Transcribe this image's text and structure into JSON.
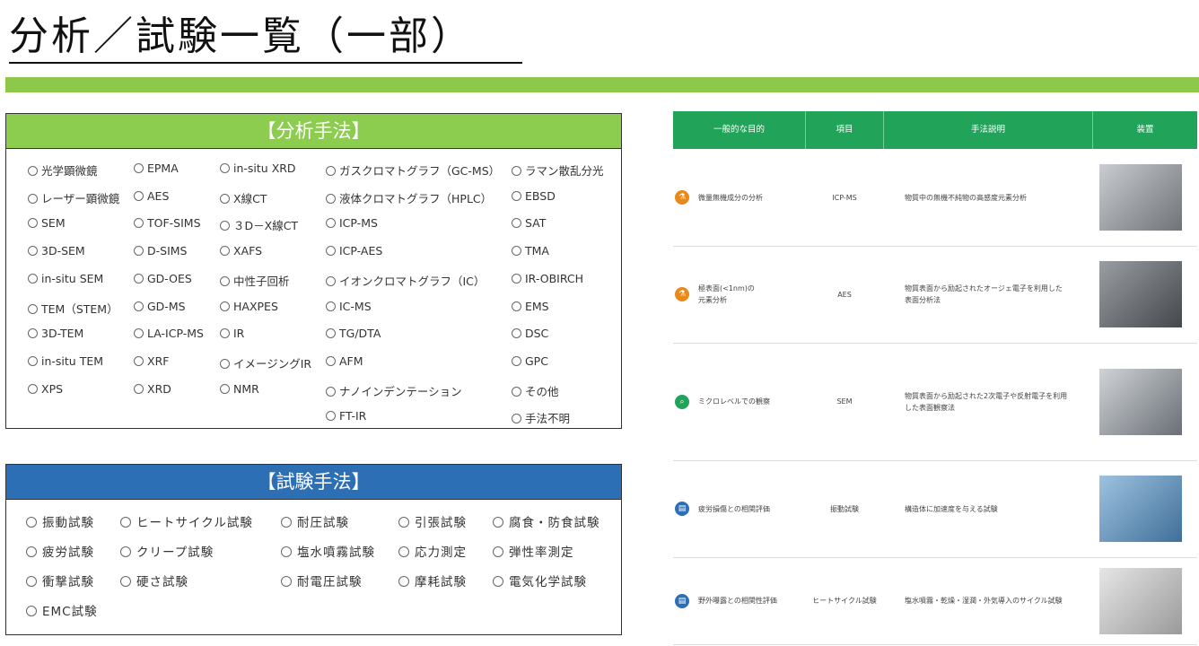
{
  "title": "分析／試験一覧（一部）",
  "colors": {
    "green_band": "#8dc84b",
    "analysis_header": "#8ccd4f",
    "test_header": "#2d6fb5",
    "table_header": "#21a35a"
  },
  "analysis": {
    "heading": "【分析手法】",
    "columns": [
      [
        "光学顕微鏡",
        "レーザー顕微鏡",
        "SEM",
        "3D-SEM",
        "in-situ SEM",
        "TEM（STEM）",
        "3D-TEM",
        "in-situ TEM",
        "XPS"
      ],
      [
        "EPMA",
        "AES",
        "TOF-SIMS",
        "D-SIMS",
        "GD-OES",
        "GD-MS",
        "LA-ICP-MS",
        "XRF",
        "XRD"
      ],
      [
        "in-situ XRD",
        "X線CT",
        "３D－X線CT",
        "XAFS",
        "中性子回析",
        "HAXPES",
        "IR",
        "イメージングIR",
        "NMR"
      ],
      [
        "ガスクロマトグラフ（GC-MS）",
        "液体クロマトグラフ（HPLC）",
        "ICP-MS",
        "ICP-AES",
        "イオンクロマトグラフ（IC）",
        "IC-MS",
        "TG/DTA",
        "AFM",
        "ナノインデンテーション",
        "FT-IR"
      ],
      [
        "ラマン散乱分光",
        "EBSD",
        "SAT",
        "TMA",
        "IR-OBIRCH",
        "EMS",
        "DSC",
        "GPC",
        "その他",
        "手法不明"
      ]
    ]
  },
  "test": {
    "heading": "【試験手法】",
    "columns": [
      [
        "振動試験",
        "疲労試験",
        "衝撃試験",
        "EMC試験"
      ],
      [
        "ヒートサイクル試験",
        "クリープ試験",
        "硬さ試験"
      ],
      [
        "耐圧試験",
        "塩水噴霧試験",
        "耐電圧試験"
      ],
      [
        "引張試験",
        "応力測定",
        "摩耗試験"
      ],
      [
        "腐食・防食試験",
        "弾性率測定",
        "電気化学試験"
      ]
    ]
  },
  "table": {
    "headers": [
      "一般的な目的",
      "項目",
      "手法説明",
      "装置"
    ],
    "rows": [
      {
        "icon": "flask-icon",
        "icon_color": "#e8891a",
        "purpose": [
          "微量無機成分の分析"
        ],
        "item": "ICP-MS",
        "desc": [
          "物質中の無機不純物の高感度元素分析"
        ]
      },
      {
        "icon": "flask-icon",
        "icon_color": "#e8891a",
        "purpose": [
          "極表面(<1nm)の",
          "元素分析"
        ],
        "item": "AES",
        "desc": [
          "物質表面から励起されたオージェ電子を利用した",
          "表面分析法"
        ]
      },
      {
        "icon": "magnifier-icon",
        "icon_color": "#21a35a",
        "purpose": [
          "ミクロレベルでの観察"
        ],
        "item": "SEM",
        "desc": [
          "物質表面から励起された2次電子や反射電子を利用",
          "した表面観察法"
        ]
      },
      {
        "icon": "document-icon",
        "icon_color": "#2d6fb5",
        "purpose": [
          "疲労損傷との相関評価"
        ],
        "item": "振動試験",
        "desc": [
          "構造体に加速度を与える試験"
        ]
      },
      {
        "icon": "document-icon",
        "icon_color": "#2d6fb5",
        "purpose": [
          "野外曝露との相関性評価"
        ],
        "item": "ヒートサイクル試験",
        "desc": [
          "塩水噴霧・乾燥・湿潤・外気導入のサイクル試験"
        ]
      }
    ]
  }
}
